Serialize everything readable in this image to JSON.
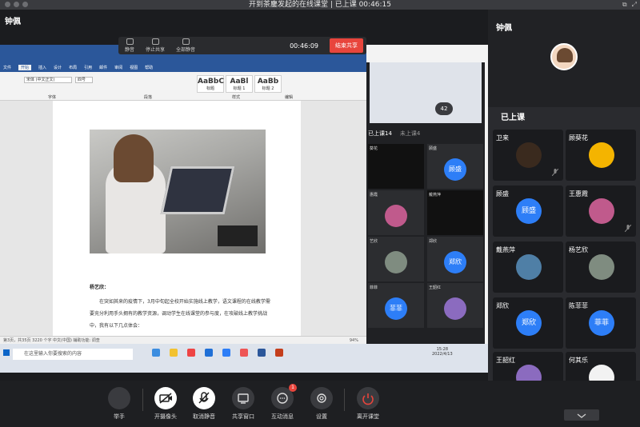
{
  "window": {
    "title": "开到茶鏖发起的在线课堂 | 已上课 00:46:15"
  },
  "presenter": {
    "name": "钟佩"
  },
  "share_toolbar": {
    "tools": [
      "静音",
      "停止共享",
      "全部静音"
    ],
    "timer": "00:46:09",
    "stop_label": "结束共享"
  },
  "word": {
    "tabs": [
      "文件",
      "开始",
      "插入",
      "设计",
      "布局",
      "引用",
      "邮件",
      "审阅",
      "视图",
      "帮助"
    ],
    "font_name": "宋体 (中文正文)",
    "font_size": "四号",
    "styles": [
      {
        "preview": "AaBbC",
        "label": "标题"
      },
      {
        "preview": "AaBl",
        "label": "标题 1"
      },
      {
        "preview": "AaBb",
        "label": "标题 2"
      }
    ],
    "group_labels": [
      "字体",
      "段落",
      "样式",
      "编辑"
    ],
    "doc_author": "杨艺欣：",
    "doc_paragraph": "在突如其来的疫情下，3月中旬起全校开始实施线上教学，语文课程的在线教学需要充分利用手头拥有的教学资源，调动学生在线课堂的参与度，在攻破线上教学挑战中，我有以下几点体会：",
    "status": "第3页，共35页   3220 个字   中文(中国)   辅助功能: 调查",
    "zoom": "94%"
  },
  "mini_meeting": {
    "badge": "42",
    "tab_active": "已上课14",
    "tab_inactive": "未上课4",
    "tiles": [
      {
        "name": "葵花",
        "avatar": ""
      },
      {
        "name": "顾盛",
        "avatar": "顾盛"
      },
      {
        "name": "惠霞",
        "avatar": ""
      },
      {
        "name": "戴燕萍",
        "avatar": ""
      },
      {
        "name": "艺欣",
        "avatar": ""
      },
      {
        "name": "郑欣",
        "avatar": "郑欣"
      },
      {
        "name": "菲菲",
        "avatar": "菲菲"
      },
      {
        "name": "王韶红",
        "avatar": ""
      }
    ]
  },
  "taskbar": {
    "search_placeholder": "在这里输入你要搜索的内容",
    "time": "15:28",
    "date": "2022/4/13"
  },
  "right_panel": {
    "teacher": "钟佩",
    "section_title": "已上课",
    "students": [
      {
        "name": "卫来",
        "avatar_text": "",
        "color": "#3a2a1e"
      },
      {
        "name": "顾葵花",
        "avatar_text": "",
        "color": "#f4b400"
      },
      {
        "name": "顾盛",
        "avatar_text": "顾盛",
        "color": "#2d7ef7"
      },
      {
        "name": "王惠霞",
        "avatar_text": "",
        "color": "#c05a8c"
      },
      {
        "name": "戴燕萍",
        "avatar_text": "",
        "color": "#4f7fa6"
      },
      {
        "name": "杨艺欣",
        "avatar_text": "",
        "color": "#7f8c80"
      },
      {
        "name": "郑欣",
        "avatar_text": "郑欣",
        "color": "#2d7ef7"
      },
      {
        "name": "陈菲菲",
        "avatar_text": "菲菲",
        "color": "#2d7ef7"
      },
      {
        "name": "王韶红",
        "avatar_text": "",
        "color": "#8b6bbf"
      },
      {
        "name": "何其乐",
        "avatar_text": "",
        "color": "#f2f2f2"
      }
    ]
  },
  "controls": [
    {
      "label": "举手",
      "icon": "hand-icon"
    },
    {
      "label": "开摄像头",
      "icon": "camera-off-icon"
    },
    {
      "label": "取消静音",
      "icon": "mic-off-icon"
    },
    {
      "label": "共享窗口",
      "icon": "share-screen-icon"
    },
    {
      "label": "互动消息",
      "icon": "chat-icon",
      "badge": "1"
    },
    {
      "label": "设置",
      "icon": "gear-icon"
    },
    {
      "label": "离开课堂",
      "icon": "power-icon"
    }
  ],
  "colors": {
    "accent": "#2d7ef7",
    "danger": "#e8453c",
    "panel": "#2a2b2f"
  }
}
